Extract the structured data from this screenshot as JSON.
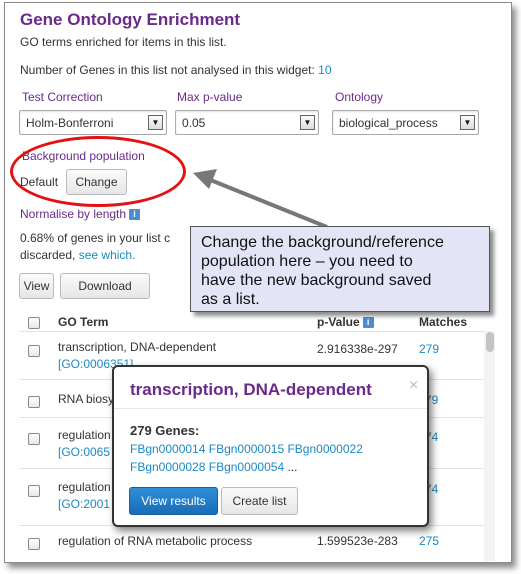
{
  "header": {
    "title": "Gene Ontology Enrichment",
    "subtitle": "GO terms enriched for items in this list.",
    "not_analysed_label": "Number of Genes in this list not analysed in this widget:",
    "not_analysed_count": "10"
  },
  "filters": {
    "test_correction": {
      "label": "Test Correction",
      "value": "Holm-Bonferroni"
    },
    "max_pvalue": {
      "label": "Max p-value",
      "value": "0.05"
    },
    "ontology": {
      "label": "Ontology",
      "value": "biological_process"
    }
  },
  "background": {
    "label": "Background population",
    "value": "Default",
    "change_label": "Change"
  },
  "normalise": {
    "label": "Normalise by length",
    "info_icon": "i"
  },
  "stats": {
    "line1": "0.68% of genes in your list c",
    "line2_prefix": "discarded,",
    "see_which": "see which."
  },
  "actions": {
    "view_label": "View",
    "download_label": "Download"
  },
  "table": {
    "columns": {
      "term": "GO Term",
      "pvalue": "p-Value",
      "matches": "Matches"
    },
    "rows": [
      {
        "term": "transcription, DNA-dependent",
        "go_id": "[GO:0006351]",
        "pvalue": "2.916338e-297",
        "matches": "279"
      },
      {
        "term": "RNA biosy",
        "go_id": "",
        "pvalue": "",
        "matches": "79"
      },
      {
        "term": "regulation",
        "go_id": "[GO:0065",
        "pvalue": "",
        "matches": "74"
      },
      {
        "term": "regulation",
        "go_id": "[GO:2001",
        "pvalue": "",
        "matches": "74"
      },
      {
        "term": "regulation of RNA metabolic process",
        "go_id": "",
        "pvalue": "1.599523e-283",
        "matches": "275"
      }
    ]
  },
  "callout": {
    "lines": [
      "Change the background/reference",
      "population here – you need to",
      "have the new background saved",
      "as a list."
    ]
  },
  "popover": {
    "title": "transcription, DNA-dependent",
    "close": "×",
    "genes_label": "279 Genes:",
    "genes_line1": "FBgn0000014 FBgn0000015 FBgn0000022",
    "genes_line2": "FBgn0000028 FBgn0000054",
    "genes_more": " ...",
    "view_results_label": "View results",
    "create_list_label": "Create list"
  },
  "colors": {
    "title_purple": "#6a2a8a",
    "link_blue": "#1a8ac6",
    "annotation_red": "#e31212",
    "callout_bg": "#e4e4f7",
    "primary_button": "#1a6cb8"
  }
}
